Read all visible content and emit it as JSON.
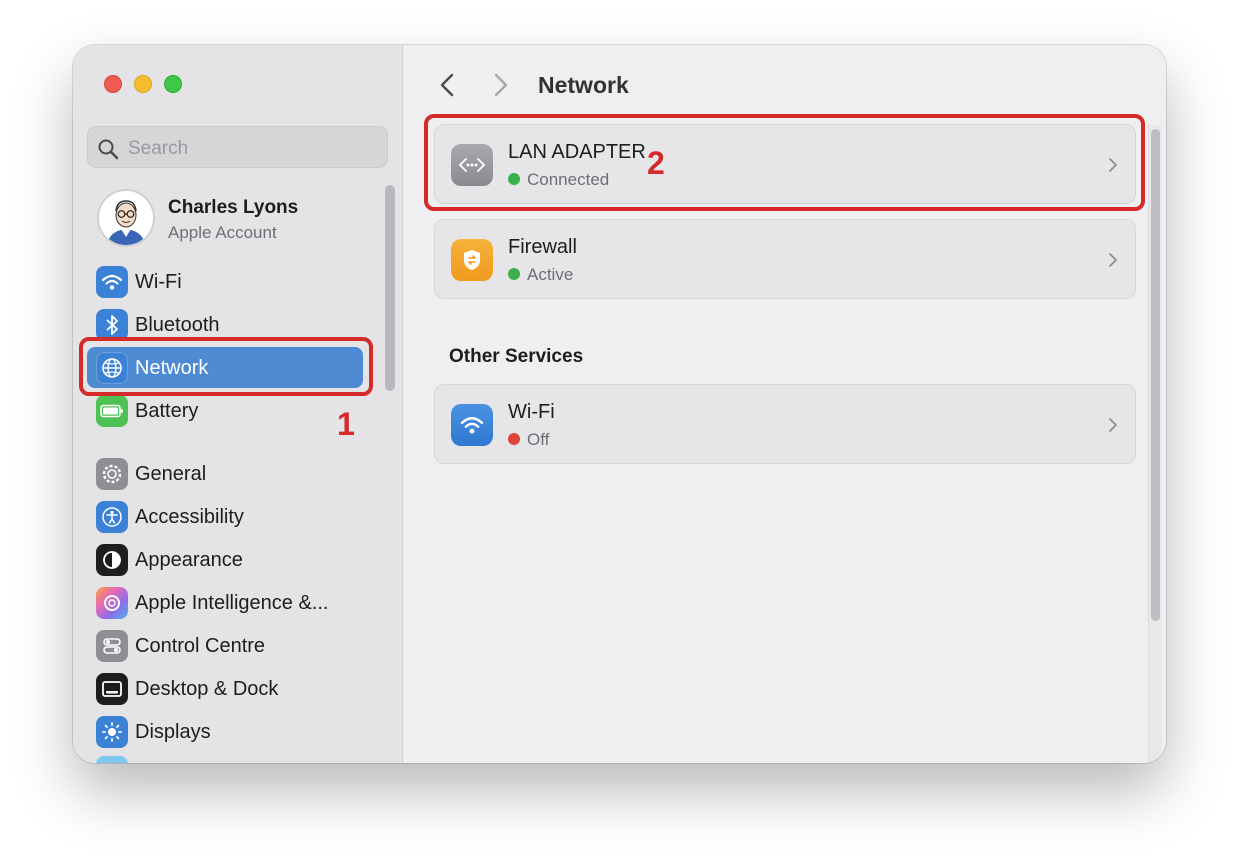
{
  "window": {
    "sidebar": {
      "search_placeholder": "Search",
      "account": {
        "name": "Charles Lyons",
        "subtitle": "Apple Account"
      },
      "items": [
        {
          "label": "Wi-Fi",
          "icon": "wifi-icon",
          "color": "#3b82d6"
        },
        {
          "label": "Bluetooth",
          "icon": "bluetooth-icon",
          "color": "#3b82d6"
        },
        {
          "label": "Network",
          "icon": "globe-icon",
          "color": "#3b82d6",
          "selected": true
        },
        {
          "label": "Battery",
          "icon": "battery-icon",
          "color": "#4cc154"
        },
        {
          "label": "General",
          "icon": "gear-icon",
          "color": "#8e8e93"
        },
        {
          "label": "Accessibility",
          "icon": "accessibility-icon",
          "color": "#3b82d6"
        },
        {
          "label": "Appearance",
          "icon": "appearance-icon",
          "color": "#1d1d1f"
        },
        {
          "label": "Apple Intelligence &...",
          "icon": "apple-intelligence-icon",
          "color": "#e86bb0"
        },
        {
          "label": "Control Centre",
          "icon": "control-centre-icon",
          "color": "#8e8e93"
        },
        {
          "label": "Desktop & Dock",
          "icon": "desktop-dock-icon",
          "color": "#1d1d1f"
        },
        {
          "label": "Displays",
          "icon": "displays-icon",
          "color": "#3b82d6"
        }
      ]
    },
    "main": {
      "title": "Network",
      "services": [
        {
          "name": "LAN ADAPTER",
          "status": "Connected",
          "status_color": "#3ab04a",
          "icon": "ethernet-icon"
        },
        {
          "name": "Firewall",
          "status": "Active",
          "status_color": "#3ab04a",
          "icon": "firewall-icon"
        }
      ],
      "other_services_title": "Other Services",
      "other_services": [
        {
          "name": "Wi-Fi",
          "status": "Off",
          "status_color": "#e0443a",
          "icon": "wifi-icon"
        }
      ]
    }
  },
  "annotations": [
    {
      "label": "1",
      "color": "#d42a2a"
    },
    {
      "label": "2",
      "color": "#d42a2a"
    }
  ]
}
